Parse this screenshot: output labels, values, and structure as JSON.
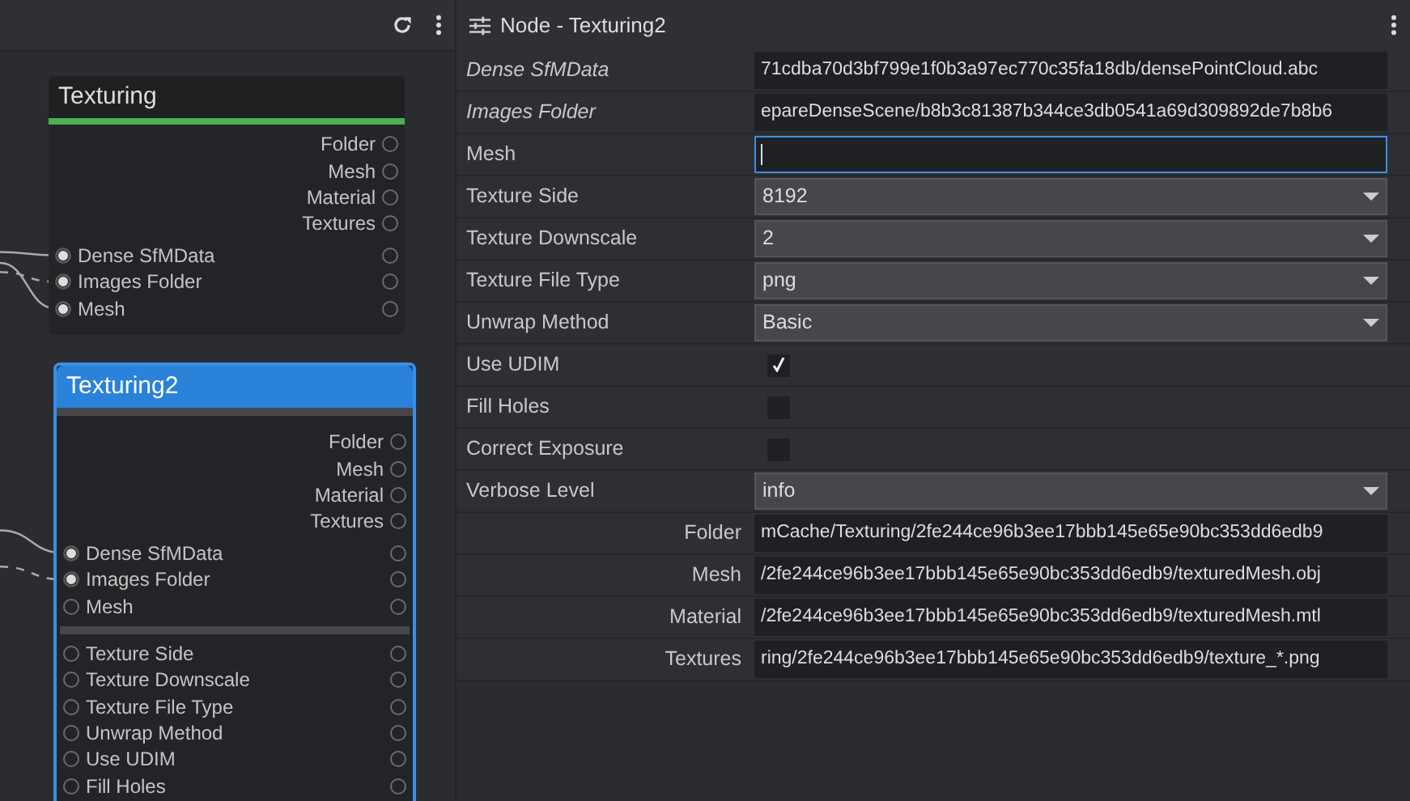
{
  "graph": {
    "nodes": [
      {
        "title": "Texturing",
        "selected": false,
        "color": "#4caf50",
        "outputs": [
          "Folder",
          "Mesh",
          "Material",
          "Textures"
        ],
        "inputs": [
          {
            "label": "Dense SfMData",
            "connected": true,
            "dashed": false
          },
          {
            "label": "Images Folder",
            "connected": true,
            "dashed": true
          },
          {
            "label": "Mesh",
            "connected": true,
            "dashed": false
          }
        ]
      },
      {
        "title": "Texturing2",
        "selected": true,
        "outputs": [
          "Folder",
          "Mesh",
          "Material",
          "Textures"
        ],
        "inputs": [
          {
            "label": "Dense SfMData",
            "connected": true,
            "dashed": false
          },
          {
            "label": "Images Folder",
            "connected": true,
            "dashed": true
          },
          {
            "label": "Mesh",
            "connected": false
          }
        ],
        "params": [
          "Texture Side",
          "Texture Downscale",
          "Texture File Type",
          "Unwrap Method",
          "Use UDIM",
          "Fill Holes"
        ]
      }
    ]
  },
  "panel": {
    "title": "Node - Texturing2",
    "attributes": [
      {
        "kind": "file",
        "label": "Dense SfMData",
        "linked": true,
        "value": "71cdba70d3bf799e1f0b3a97ec770c35fa18db/densePointCloud.abc"
      },
      {
        "kind": "file",
        "label": "Images Folder",
        "linked": true,
        "value": "epareDenseScene/b8b3c81387b344ce3db0541a69d309892de7b8b6"
      },
      {
        "kind": "text",
        "label": "Mesh",
        "linked": false,
        "focused": true
      },
      {
        "kind": "choice",
        "label": "Texture Side",
        "linked": false,
        "value": "8192"
      },
      {
        "kind": "choice",
        "label": "Texture Downscale",
        "linked": false,
        "value": "2"
      },
      {
        "kind": "choice",
        "label": "Texture File Type",
        "linked": false,
        "value": "png"
      },
      {
        "kind": "choice",
        "label": "Unwrap Method",
        "linked": false,
        "value": "Basic"
      },
      {
        "kind": "checkbox",
        "label": "Use UDIM",
        "linked": false,
        "checked": true
      },
      {
        "kind": "checkbox",
        "label": "Fill Holes",
        "linked": false,
        "checked": false
      },
      {
        "kind": "checkbox",
        "label": "Correct Exposure",
        "linked": false,
        "checked": false
      },
      {
        "kind": "choice",
        "label": "Verbose Level",
        "linked": false,
        "value": "info"
      },
      {
        "kind": "output",
        "label": "Folder",
        "linked": false,
        "value": "mCache/Texturing/2fe244ce96b3ee17bbb145e65e90bc353dd6edb9"
      },
      {
        "kind": "output",
        "label": "Mesh",
        "linked": false,
        "value": "/2fe244ce96b3ee17bbb145e65e90bc353dd6edb9/texturedMesh.obj"
      },
      {
        "kind": "output",
        "label": "Material",
        "linked": false,
        "value": "/2fe244ce96b3ee17bbb145e65e90bc353dd6edb9/texturedMesh.mtl"
      },
      {
        "kind": "output",
        "label": "Textures",
        "linked": false,
        "value": "ring/2fe244ce96b3ee17bbb145e65e90bc353dd6edb9/texture_*.png"
      }
    ]
  }
}
